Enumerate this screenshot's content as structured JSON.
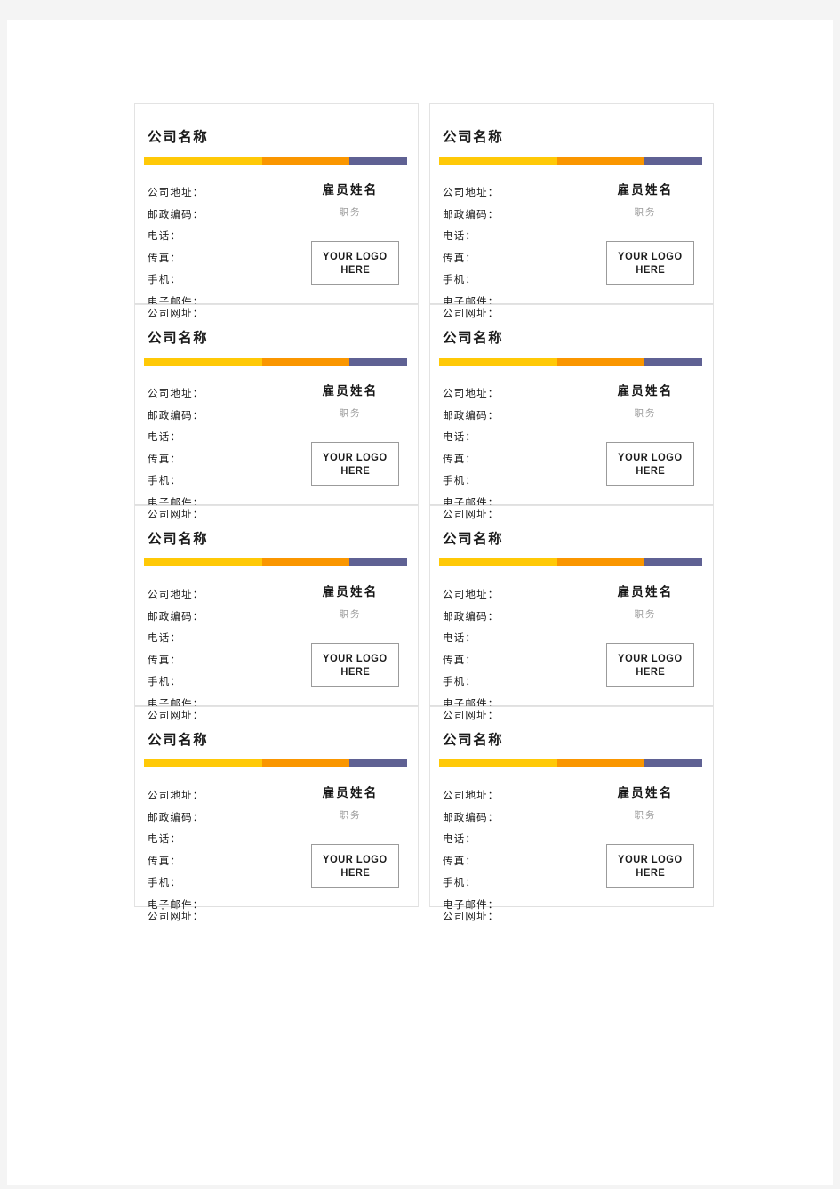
{
  "document": {
    "kind": "business-card-template-sheet",
    "columns": 2,
    "rows": 4,
    "total_cards": 8
  },
  "colors": {
    "bar_yellow": "#FFC907",
    "bar_orange": "#FA9600",
    "bar_purple": "#5F6193",
    "card_border": "#E3E3E3",
    "logo_border": "#9B9B9B",
    "role_text": "#9A9A9A",
    "title_text": "#1A1A1A",
    "page_background": "#F4F4F4",
    "sheet_background": "#FFFFFF"
  },
  "card": {
    "company_name": "公司名称",
    "fields": [
      {
        "label": "公司地址：",
        "name": "company-address"
      },
      {
        "label": "邮政编码：",
        "name": "postal-code"
      },
      {
        "label": "电话：",
        "name": "telephone"
      },
      {
        "label": "传真：",
        "name": "fax"
      },
      {
        "label": "手机：",
        "name": "mobile"
      },
      {
        "label": "电子邮件：",
        "name": "email"
      }
    ],
    "website_label": "公司网址：",
    "employee_name": "雇员姓名",
    "employee_role": "职务",
    "logo_placeholder": {
      "line1": "YOUR LOGO",
      "line2": "HERE"
    }
  },
  "cards": [
    {
      "id": "card-1",
      "row": 1,
      "column": 1
    },
    {
      "id": "card-2",
      "row": 1,
      "column": 2
    },
    {
      "id": "card-3",
      "row": 2,
      "column": 1
    },
    {
      "id": "card-4",
      "row": 2,
      "column": 2
    },
    {
      "id": "card-5",
      "row": 3,
      "column": 1
    },
    {
      "id": "card-6",
      "row": 3,
      "column": 2
    },
    {
      "id": "card-7",
      "row": 4,
      "column": 1
    },
    {
      "id": "card-8",
      "row": 4,
      "column": 2
    }
  ]
}
